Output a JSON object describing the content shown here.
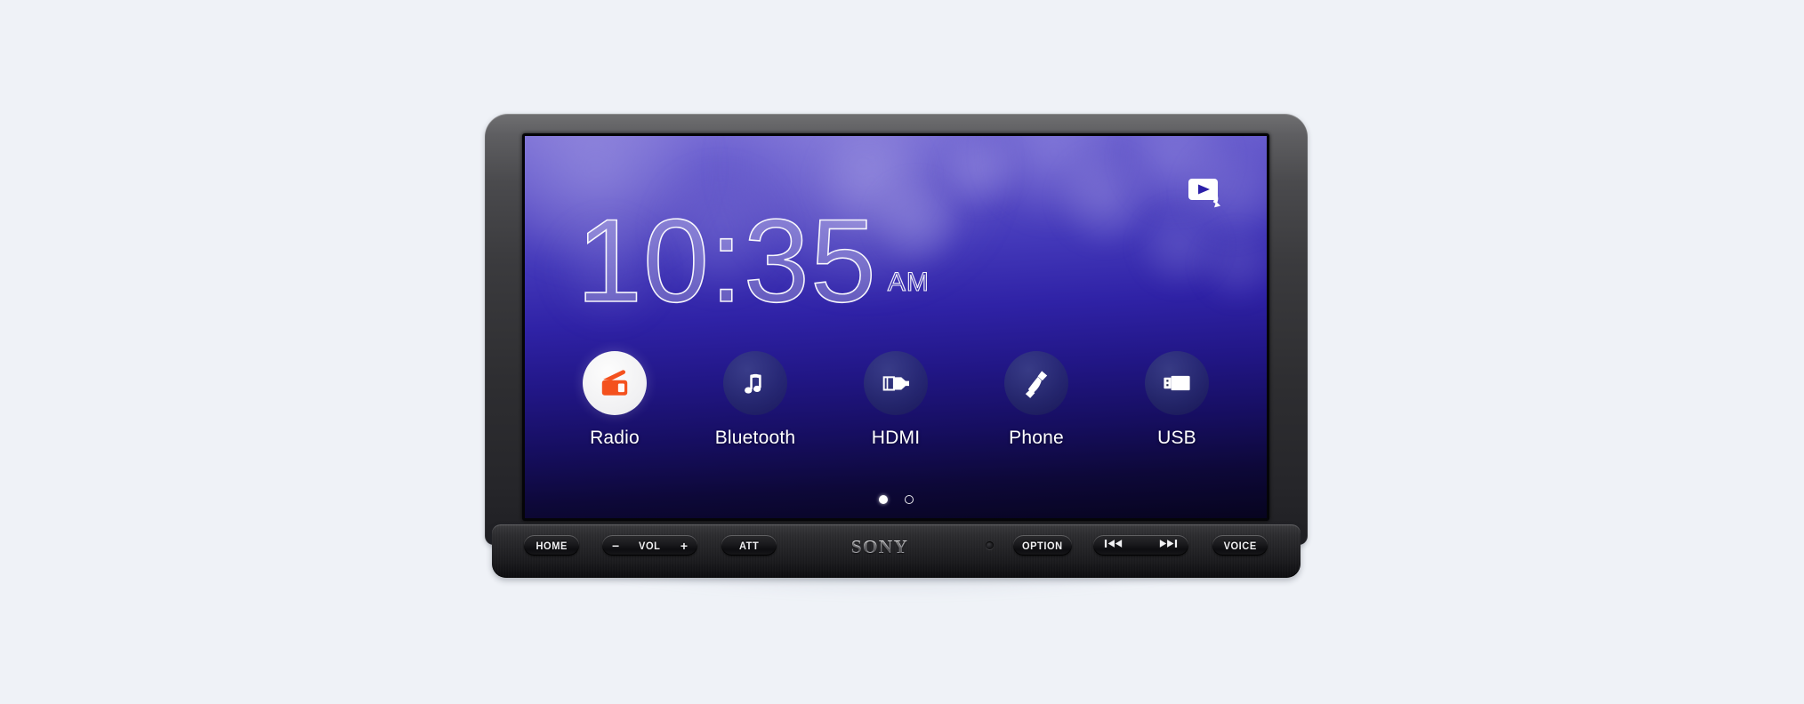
{
  "device": {
    "brand": "SONY",
    "kind": "car-audio-receiver",
    "page_background": "#eff2f7"
  },
  "screen": {
    "wallpaper": {
      "type": "bokeh-gradient",
      "gradient_top": "#7b6fd6",
      "gradient_bottom": "#07041f"
    },
    "status": {
      "resume_source_icon": "play-resume-source-icon"
    },
    "clock": {
      "time": "10:35",
      "meridiem": "AM",
      "hours": "10",
      "minutes": "35",
      "style": "outline-thin",
      "color": "#ffffff"
    },
    "sources": [
      {
        "label": "Radio",
        "icon": "radio-icon",
        "circle": "light",
        "accent": "#f4511e",
        "selected": true
      },
      {
        "label": "Bluetooth",
        "icon": "music-note-icon",
        "circle": "dim",
        "accent": "#ffffff",
        "selected": false
      },
      {
        "label": "HDMI",
        "icon": "hdmi-plug-icon",
        "circle": "dim",
        "accent": "#ffffff",
        "selected": false
      },
      {
        "label": "Phone",
        "icon": "phone-handset-icon",
        "circle": "dim",
        "accent": "#ffffff",
        "selected": false
      },
      {
        "label": "USB",
        "icon": "usb-stick-icon",
        "circle": "dim",
        "accent": "#ffffff",
        "selected": false
      }
    ],
    "pagination": {
      "pages": 2,
      "current": 1,
      "dots": [
        {
          "active": true
        },
        {
          "active": false
        }
      ]
    }
  },
  "control_bar": {
    "buttons": {
      "home": {
        "label": "HOME"
      },
      "volume": {
        "label": "VOL",
        "minus": "−",
        "plus": "+"
      },
      "att": {
        "label": "ATT"
      },
      "option": {
        "label": "OPTION"
      },
      "track": {
        "prev": "⏮",
        "next": "⏭"
      },
      "voice": {
        "label": "VOICE"
      }
    },
    "logo": "SONY",
    "mic": "microphone-hole"
  }
}
